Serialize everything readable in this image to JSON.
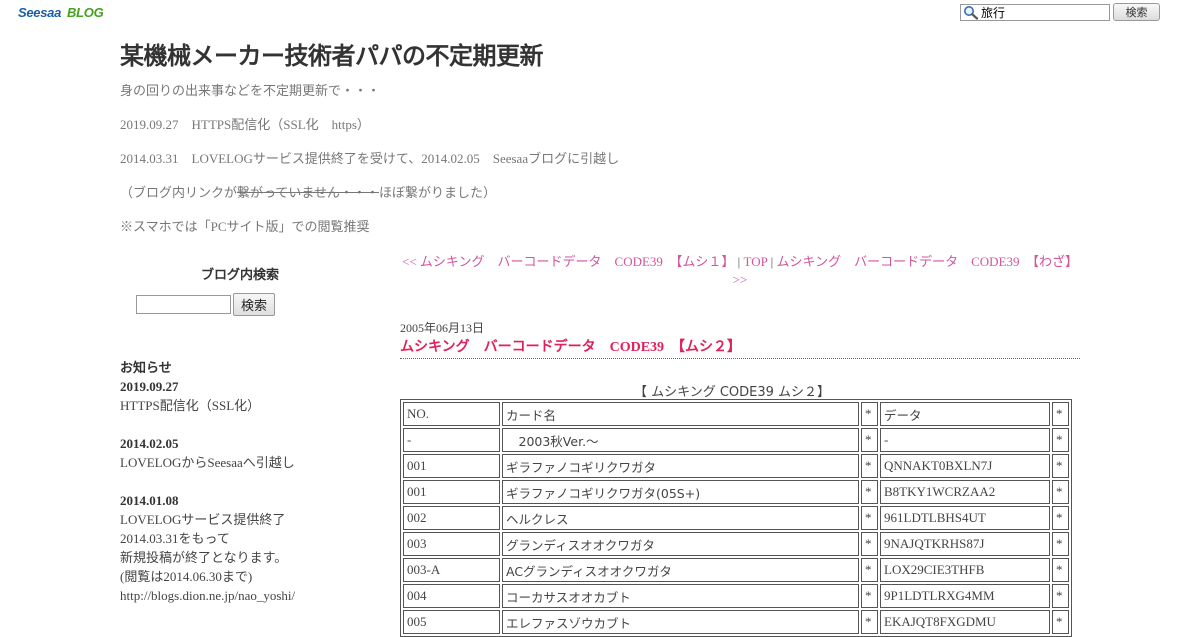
{
  "topbar": {
    "logo_main": "Seesaa",
    "logo_sub": "BLOG",
    "search_value": "旅行",
    "search_button": "検索",
    "search_icon": "search-icon"
  },
  "header": {
    "title": "某機械メーカー技術者パパの不定期更新",
    "lines": [
      "身の回りの出来事などを不定期更新で・・・",
      "2019.09.27　HTTPS配信化（SSL化　https）",
      "2014.03.31　LOVELOGサービス提供終了を受けて、2014.02.05　Seesaaブログに引越し",
      "※スマホでは「PCサイト版」での閲覧推奨"
    ],
    "paren_open": "（ブログ内リンクが",
    "strike_text": "繋がっていません・・・",
    "paren_close": "ほぼ繋がりました）"
  },
  "sidebar": {
    "search_title": "ブログ内検索",
    "search_button": "検索",
    "notice_title": "お知らせ",
    "notices": [
      {
        "date": "2019.09.27",
        "lines": [
          "HTTPS配信化（SSL化）"
        ]
      },
      {
        "date": "2014.02.05",
        "lines": [
          "LOVELOGからSeesaaへ引越し"
        ]
      },
      {
        "date": "2014.01.08",
        "lines": [
          "LOVELOGサービス提供終了",
          "2014.03.31をもって",
          "新規投稿が終了となります。",
          "(閲覧は2014.06.30まで)",
          "http://blogs.dion.ne.jp/nao_yoshi/"
        ]
      }
    ]
  },
  "nav": {
    "prev": "<< ムシキング　バーコードデータ　CODE39　【ムシ１】",
    "sep1": " | ",
    "top": "TOP",
    "sep2": " | ",
    "next": "ムシキング　バーコードデータ　CODE39　【わざ】 >>"
  },
  "post": {
    "date": "2005年06月13日",
    "title": "ムシキング　バーコードデータ　CODE39　【ムシ２】",
    "table_caption": "【 ムシキング CODE39 ムシ２】",
    "table_headers": [
      "NO.",
      "カード名",
      "*",
      "データ",
      "*"
    ],
    "rows": [
      [
        "-",
        "　2003秋Ver.～",
        "*",
        "-",
        "*"
      ],
      [
        "001",
        "ギラファノコギリクワガタ",
        "*",
        "QNNAKT0BXLN7J",
        "*"
      ],
      [
        "001",
        "ギラファノコギリクワガタ(05S+)",
        "*",
        "B8TKY1WCRZAA2",
        "*"
      ],
      [
        "002",
        "ヘルクレス",
        "*",
        "961LDTLBHS4UT",
        "*"
      ],
      [
        "003",
        "グランディスオオクワガタ",
        "*",
        "9NAJQTKRHS87J",
        "*"
      ],
      [
        "003-A",
        "ACグランディスオオクワガタ",
        "*",
        "LOX29CIE3THFB",
        "*"
      ],
      [
        "004",
        "コーカサスオオカブト",
        "*",
        "9P1LDTLRXG4MM",
        "*"
      ],
      [
        "005",
        "エレファスゾウカブト",
        "*",
        "EKAJQT8FXGDMU",
        "*"
      ]
    ]
  }
}
